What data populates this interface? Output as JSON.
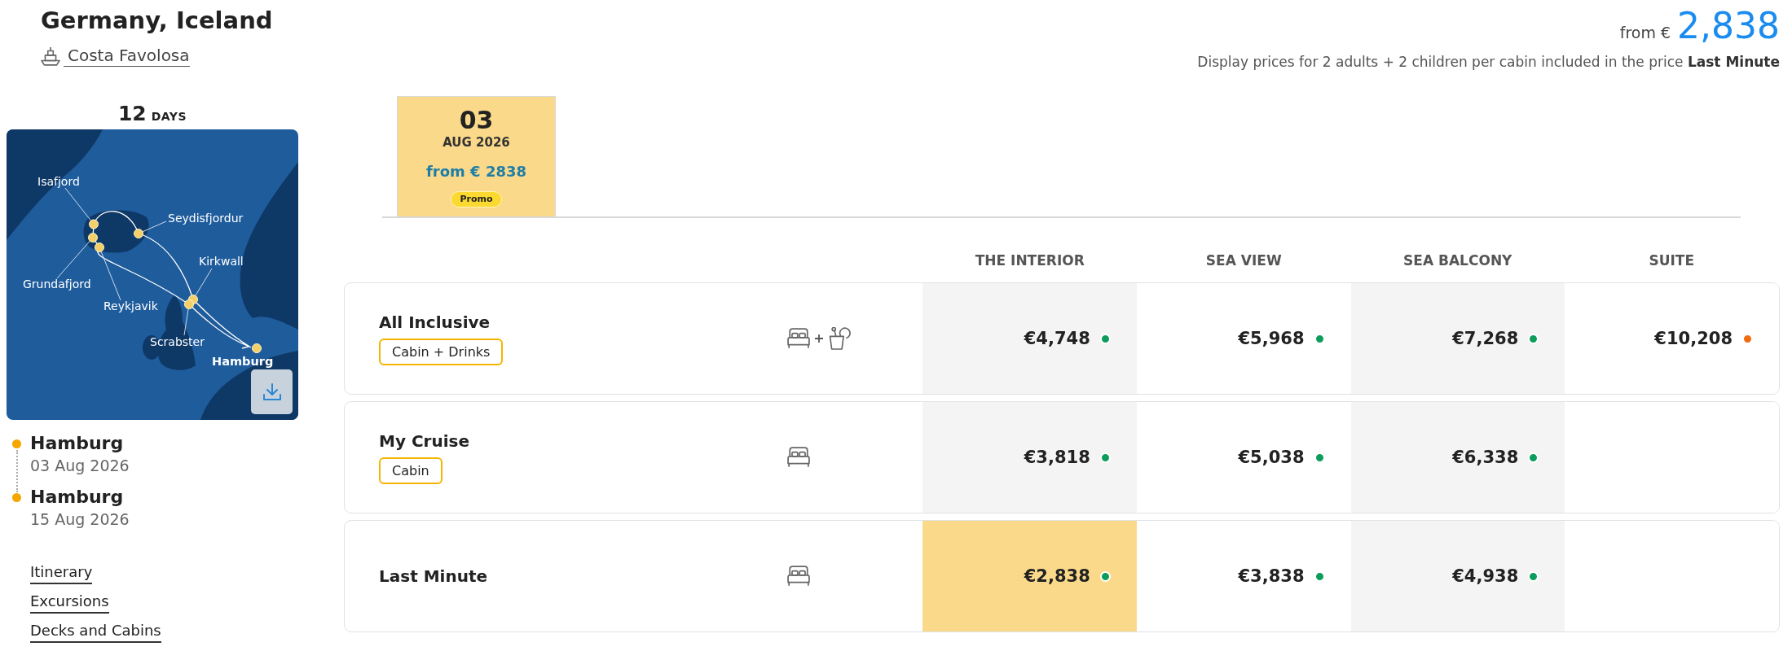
{
  "header": {
    "title": "Germany, Iceland",
    "ship": "Costa Favolosa",
    "price_prefix": "from €",
    "price": "2,838",
    "note": "Display prices for 2 adults + 2 children per cabin included in the price **Last Minute**"
  },
  "sidebar": {
    "duration": {
      "value": "12",
      "unit": "DAYS"
    },
    "map": {
      "ports": [
        {
          "label": "Isafjord",
          "kind": "stop"
        },
        {
          "label": "Seydisfjordur",
          "kind": "stop"
        },
        {
          "label": "Kirkwall",
          "kind": "stop"
        },
        {
          "label": "Grundafjord",
          "kind": "stop"
        },
        {
          "label": "Reykjavik",
          "kind": "stop"
        },
        {
          "label": "Scrabster",
          "kind": "stop"
        },
        {
          "label": "Hamburg",
          "kind": "home"
        }
      ]
    },
    "itinerary": [
      {
        "port": "Hamburg",
        "date": "03 Aug 2026"
      },
      {
        "port": "Hamburg",
        "date": "15 Aug 2026"
      }
    ],
    "links": [
      "Itinerary",
      "Excursions",
      "Decks and Cabins"
    ]
  },
  "dates": [
    {
      "day": "03",
      "month": "AUG 2026",
      "price": "from € 2838",
      "badge": "Promo",
      "selected": true
    }
  ],
  "table": {
    "columns": [
      "THE INTERIOR",
      "SEA VIEW",
      "SEA BALCONY",
      "SUITE"
    ],
    "rows": [
      {
        "name": "All Inclusive",
        "badge": "Cabin + Drinks",
        "drinks": true,
        "prices": [
          {
            "amount": "€4,748",
            "color": "#0c9d5c",
            "selected": false
          },
          {
            "amount": "€5,968",
            "color": "#0c9d5c",
            "selected": false
          },
          {
            "amount": "€7,268",
            "color": "#0c9d5c",
            "selected": false
          },
          {
            "amount": "€10,208",
            "color": "#f26b10",
            "selected": false
          }
        ]
      },
      {
        "name": "My Cruise",
        "badge": "Cabin",
        "drinks": false,
        "prices": [
          {
            "amount": "€3,818",
            "color": "#0c9d5c",
            "selected": false
          },
          {
            "amount": "€5,038",
            "color": "#0c9d5c",
            "selected": false
          },
          {
            "amount": "€6,338",
            "color": "#0c9d5c",
            "selected": false
          }
        ]
      },
      {
        "name": "Last Minute",
        "drinks": false,
        "prices": [
          {
            "amount": "€2,838",
            "color": "#0c9d5c",
            "selected": true
          },
          {
            "amount": "€3,838",
            "color": "#0c9d5c",
            "selected": false
          },
          {
            "amount": "€4,938",
            "color": "#0c9d5c",
            "selected": false
          }
        ]
      }
    ]
  }
}
